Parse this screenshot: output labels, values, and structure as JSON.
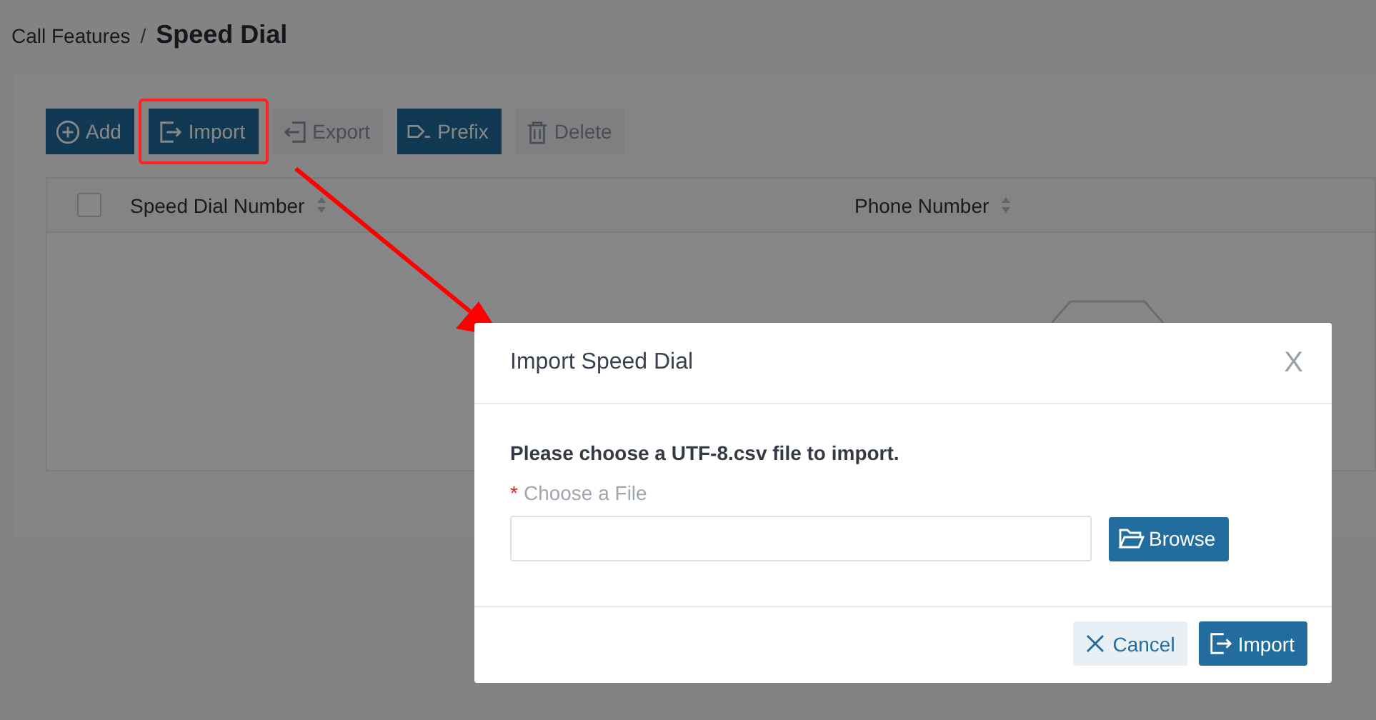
{
  "breadcrumb": {
    "parent": "Call Features",
    "separator": "/",
    "current": "Speed Dial"
  },
  "toolbar": [
    {
      "kind": "add",
      "label": "Add",
      "disabled": false
    },
    {
      "kind": "import",
      "label": "Import",
      "disabled": false
    },
    {
      "kind": "export",
      "label": "Export",
      "disabled": true
    },
    {
      "kind": "prefix",
      "label": "Prefix",
      "disabled": false
    },
    {
      "kind": "delete",
      "label": "Delete",
      "disabled": true
    }
  ],
  "table": {
    "select_all": {
      "checked": false
    },
    "columns": [
      "Speed Dial Number",
      "Phone Number"
    ]
  },
  "dialog": {
    "title": "Import Speed Dial",
    "close": "X",
    "message": "Please choose a UTF-8.csv file to import.",
    "field": {
      "required_mark": "*",
      "label": "Choose a File"
    },
    "browse": "Browse",
    "buttons": [
      {
        "kind": "cancel",
        "label": "Cancel"
      },
      {
        "kind": "import",
        "label": "Import"
      }
    ]
  }
}
